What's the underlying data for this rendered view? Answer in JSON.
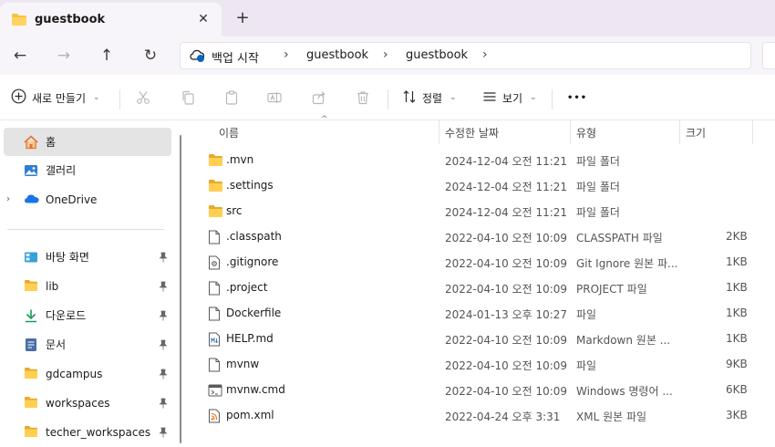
{
  "tab": {
    "title": "guestbook",
    "close": "✕",
    "new_tab": "+"
  },
  "nav": {
    "back": "←",
    "forward": "→",
    "up": "↑",
    "refresh": "↻",
    "breadcrumbs": [
      "백업 시작",
      "guestbook",
      "guestbook"
    ],
    "sep": "›"
  },
  "commands": {
    "new_label": "새로 만들기",
    "sort_label": "정렬",
    "view_label": "보기",
    "more": "•••"
  },
  "sidebar": {
    "home": "홈",
    "gallery": "갤러리",
    "onedrive": "OneDrive",
    "quick_access": [
      {
        "label": "바탕 화면",
        "icon": "desktop-icon"
      },
      {
        "label": "lib",
        "icon": "folder-icon"
      },
      {
        "label": "다운로드",
        "icon": "download-icon"
      },
      {
        "label": "문서",
        "icon": "document-icon"
      },
      {
        "label": "gdcampus",
        "icon": "folder-icon"
      },
      {
        "label": "workspaces",
        "icon": "folder-icon"
      },
      {
        "label": "techer_workspaces",
        "icon": "folder-icon"
      }
    ]
  },
  "columns": {
    "name": "이름",
    "date": "수정한 날짜",
    "type": "유형",
    "size": "크기"
  },
  "files": [
    {
      "name": ".mvn",
      "date": "2024-12-04 오전 11:21",
      "type": "파일 폴더",
      "size": "",
      "icon": "folder-icon"
    },
    {
      "name": ".settings",
      "date": "2024-12-04 오전 11:21",
      "type": "파일 폴더",
      "size": "",
      "icon": "folder-icon"
    },
    {
      "name": "src",
      "date": "2024-12-04 오전 11:21",
      "type": "파일 폴더",
      "size": "",
      "icon": "folder-icon"
    },
    {
      "name": ".classpath",
      "date": "2022-04-10 오전 10:09",
      "type": "CLASSPATH 파일",
      "size": "2KB",
      "icon": "file-icon"
    },
    {
      "name": ".gitignore",
      "date": "2022-04-10 오전 10:09",
      "type": "Git Ignore 원본 파...",
      "size": "1KB",
      "icon": "config-file-icon"
    },
    {
      "name": ".project",
      "date": "2022-04-10 오전 10:09",
      "type": "PROJECT 파일",
      "size": "1KB",
      "icon": "file-icon"
    },
    {
      "name": "Dockerfile",
      "date": "2024-01-13 오후 10:27",
      "type": "파일",
      "size": "1KB",
      "icon": "file-icon"
    },
    {
      "name": "HELP.md",
      "date": "2022-04-10 오전 10:09",
      "type": "Markdown 원본 ...",
      "size": "1KB",
      "icon": "markdown-file-icon"
    },
    {
      "name": "mvnw",
      "date": "2022-04-10 오전 10:09",
      "type": "파일",
      "size": "9KB",
      "icon": "file-icon"
    },
    {
      "name": "mvnw.cmd",
      "date": "2022-04-10 오전 10:09",
      "type": "Windows 명령어 ...",
      "size": "6KB",
      "icon": "cmd-file-icon"
    },
    {
      "name": "pom.xml",
      "date": "2022-04-24 오후 3:31",
      "type": "XML 원본 파일",
      "size": "3KB",
      "icon": "xml-file-icon"
    }
  ],
  "colors": {
    "folder": "#f5c242",
    "accent": "#0067c0",
    "tab_bar": "#eee7f2",
    "selected": "#e4e4e4"
  }
}
